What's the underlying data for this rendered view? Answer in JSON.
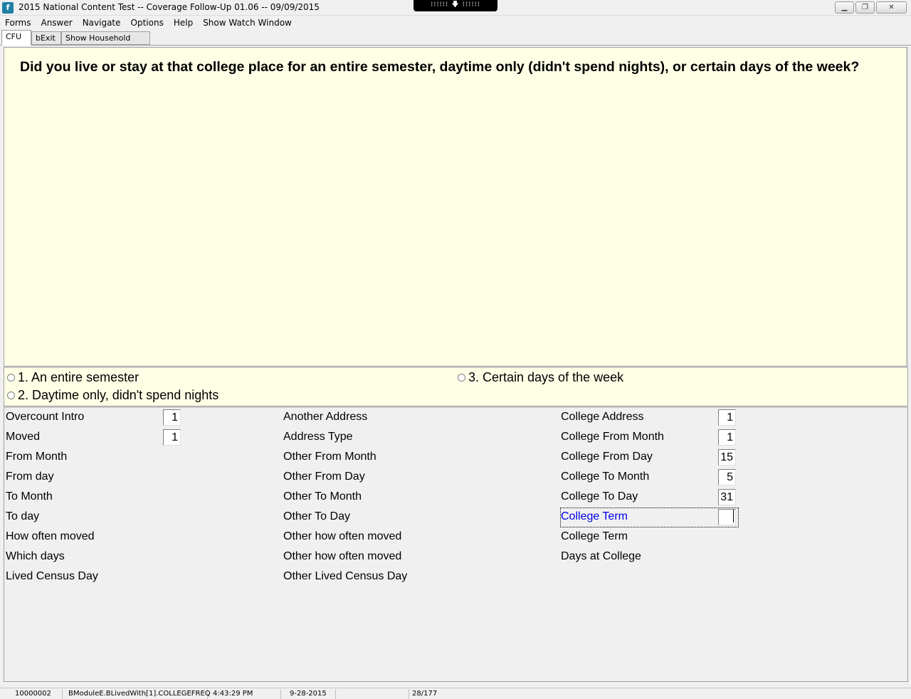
{
  "window": {
    "title": "2015 National Content Test -- Coverage Follow-Up 01.06 -- 09/09/2015",
    "remote_bar": "⁝⁝⁝⁝⁝⁝ 🡇 ⁝⁝⁝⁝⁝⁝"
  },
  "menu": [
    "Forms",
    "Answer",
    "Navigate",
    "Options",
    "Help",
    "Show Watch Window"
  ],
  "tabs": [
    "CFU",
    "bExit",
    "Show Household Roster"
  ],
  "question": "Did you live or stay at that college place for an entire semester, daytime only (didn't spend nights), or certain days of the week?",
  "options": [
    "1. An entire semester",
    "2. Daytime only, didn't spend nights",
    "3. Certain days of the week"
  ],
  "fields": {
    "col1": [
      {
        "label": "Overcount Intro",
        "value": "1"
      },
      {
        "label": "Moved",
        "value": "1"
      },
      {
        "label": "From Month",
        "value": ""
      },
      {
        "label": "From day",
        "value": ""
      },
      {
        "label": "To Month",
        "value": ""
      },
      {
        "label": "To day",
        "value": ""
      },
      {
        "label": "How often moved",
        "value": ""
      },
      {
        "label": "Which days",
        "value": ""
      },
      {
        "label": "Lived Census Day",
        "value": ""
      }
    ],
    "col2": [
      {
        "label": "Another Address"
      },
      {
        "label": "Address Type"
      },
      {
        "label": "Other From Month"
      },
      {
        "label": "Other From Day"
      },
      {
        "label": "Other To Month"
      },
      {
        "label": "Other To Day"
      },
      {
        "label": "Other how often moved"
      },
      {
        "label": "Other how often moved"
      },
      {
        "label": "Other Lived Census Day"
      }
    ],
    "col3": [
      {
        "label": "College Address",
        "value": "1"
      },
      {
        "label": "College From Month",
        "value": "1"
      },
      {
        "label": "College From Day",
        "value": "15"
      },
      {
        "label": "College To Month",
        "value": "5"
      },
      {
        "label": "College To Day",
        "value": "31"
      },
      {
        "label": "College Term",
        "value": ""
      },
      {
        "label": "College Term",
        "value": ""
      },
      {
        "label": "Days at College",
        "value": ""
      }
    ]
  },
  "status": {
    "case_id": "10000002",
    "field_path": "BModuleE.BLivedWith[1].COLLEGEFREQ",
    "time": "4:43:29 PM",
    "date": "9-28-2015",
    "blank": "",
    "page": "28/177"
  },
  "colors": {
    "question_bg": "#ffffe6",
    "active_label": "#0000ee"
  }
}
